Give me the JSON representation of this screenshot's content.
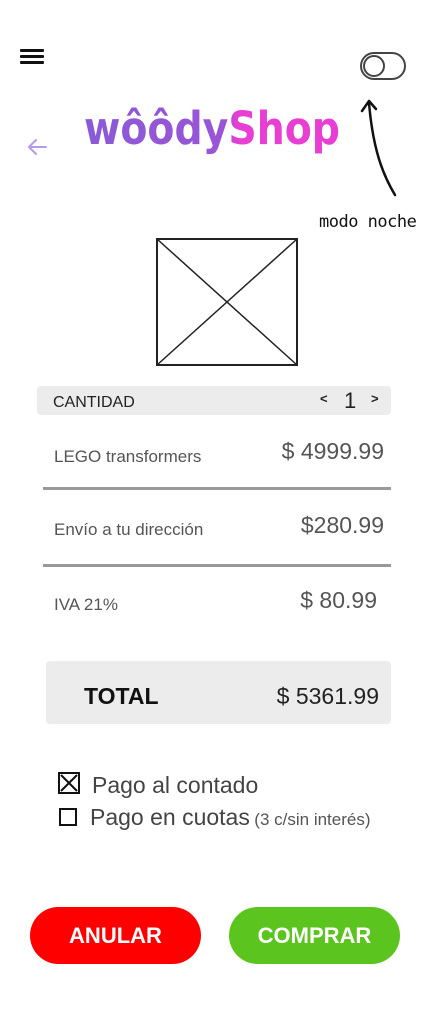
{
  "header": {
    "logo_text": "wôôdyShop",
    "theme_toggle_annotation": "modo noche"
  },
  "quantity": {
    "label": "CANTIDAD",
    "decrease": "<",
    "value": "1",
    "increase": ">"
  },
  "summary": [
    {
      "label": "LEGO transformers",
      "value": "$ 4999.99"
    },
    {
      "label": "Envío a tu dirección",
      "value": "$280.99"
    },
    {
      "label": "IVA 21%",
      "value": "$ 80.99"
    }
  ],
  "total": {
    "label": "TOTAL",
    "value": "$ 5361.99"
  },
  "payment": {
    "options": [
      {
        "label": "Pago al contado",
        "note": "",
        "checked": true
      },
      {
        "label": "Pago en cuotas",
        "note": "(3 c/sin interés)",
        "checked": false
      }
    ]
  },
  "actions": {
    "cancel": "ANULAR",
    "buy": "COMPRAR"
  },
  "colors": {
    "cancel": "#ff0000",
    "buy": "#5cc41e",
    "logo_left": "#8a5ad6",
    "logo_right": "#e83ed4",
    "back_arrow": "#b29bea"
  }
}
